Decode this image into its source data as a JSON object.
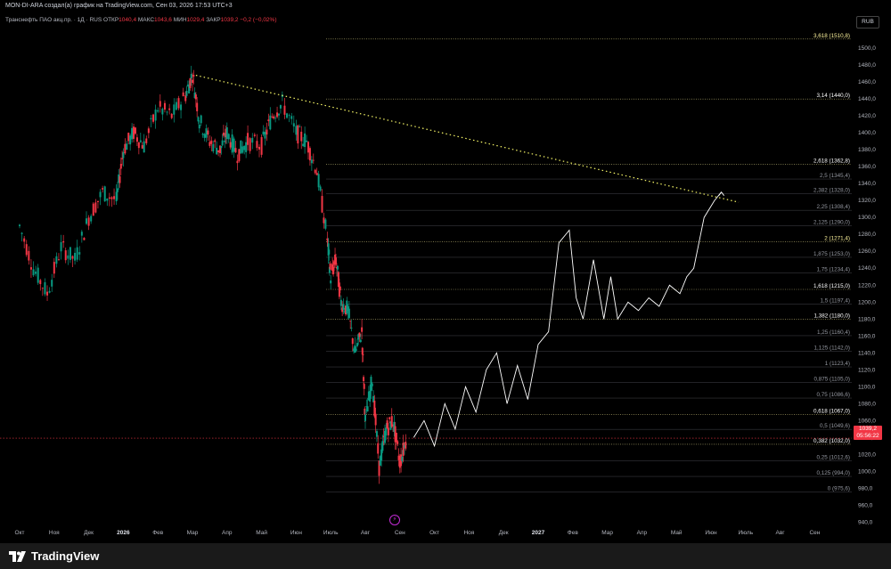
{
  "header": {
    "title": "MON-DI-ARA создал(а) график на TradingView.com, Сен 03, 2026 17:53 UTC+3",
    "symbol": "Транснефть ПАО акц.пр. · 1Д · RUS",
    "ohlc": [
      {
        "k": "ОТКР",
        "v": "1040,4"
      },
      {
        "k": "МАКС",
        "v": "1043,6"
      },
      {
        "k": "МИН",
        "v": "1029,4"
      },
      {
        "k": "ЗАКР",
        "v": "1039,2 −0,2 (−0,02%)"
      }
    ]
  },
  "currency": "RUB",
  "last_price": {
    "value": "1039,2",
    "countdown": "05:56:22",
    "color": "#f23645"
  },
  "footer": {
    "brand": "TradingView"
  },
  "colors": {
    "up": "#089981",
    "down": "#f23645",
    "fib": "#787b86",
    "fib_key": "#fff59d",
    "trend": "#f5f567",
    "projection": "#ffffff"
  },
  "chart_data": {
    "type": "line",
    "x_ticks": [
      "Окт",
      "Ноя",
      "Дек",
      "2026",
      "Фев",
      "Мар",
      "Апр",
      "Май",
      "Июн",
      "Июль",
      "Авг",
      "Сен",
      "Окт",
      "Ноя",
      "Дек",
      "2027",
      "Фев",
      "Мар",
      "Апр",
      "Май",
      "Июн",
      "Июль",
      "Авг",
      "Сен"
    ],
    "y_ticks": [
      "1500,0",
      "1480,0",
      "1460,0",
      "1440,0",
      "1420,0",
      "1400,0",
      "1380,0",
      "1360,0",
      "1340,0",
      "1320,0",
      "1300,0",
      "1280,0",
      "1260,0",
      "1240,0",
      "1220,0",
      "1200,0",
      "1180,0",
      "1160,0",
      "1140,0",
      "1120,0",
      "1100,0",
      "1080,0",
      "1060,0",
      "1040,0",
      "1020,0",
      "1000,0",
      "980,0",
      "960,0",
      "940,0"
    ],
    "ylim": [
      932,
      1510
    ],
    "fib_levels": [
      {
        "label": "3,618 (1510,8)",
        "value": 1510.8,
        "key": true
      },
      {
        "label": "3,14 (1440,0)",
        "value": 1440.0,
        "key": true
      },
      {
        "label": "2,618 (1362,8)",
        "value": 1362.8,
        "key": true
      },
      {
        "label": "2,5 (1345,4)",
        "value": 1345.4,
        "key": false
      },
      {
        "label": "2,382 (1328,0)",
        "value": 1328.0,
        "key": false
      },
      {
        "label": "2,25 (1308,4)",
        "value": 1308.4,
        "key": false
      },
      {
        "label": "2,125 (1290,0)",
        "value": 1290.0,
        "key": false
      },
      {
        "label": "2 (1271,4)",
        "value": 1271.4,
        "key": true
      },
      {
        "label": "1,875 (1253,0)",
        "value": 1253.0,
        "key": false
      },
      {
        "label": "1,75 (1234,4)",
        "value": 1234.4,
        "key": false
      },
      {
        "label": "1,618 (1215,0)",
        "value": 1215.0,
        "key": true
      },
      {
        "label": "1,5 (1197,4)",
        "value": 1197.4,
        "key": false
      },
      {
        "label": "1,382 (1180,0)",
        "value": 1180.0,
        "key": true
      },
      {
        "label": "1,25 (1160,4)",
        "value": 1160.4,
        "key": false
      },
      {
        "label": "1,125 (1142,0)",
        "value": 1142.0,
        "key": false
      },
      {
        "label": "1 (1123,4)",
        "value": 1123.4,
        "key": false
      },
      {
        "label": "0,875 (1105,0)",
        "value": 1105.0,
        "key": false
      },
      {
        "label": "0,75 (1086,6)",
        "value": 1086.6,
        "key": false
      },
      {
        "label": "0,618 (1067,0)",
        "value": 1067.0,
        "key": true
      },
      {
        "label": "0,5 (1049,6)",
        "value": 1049.6,
        "key": false
      },
      {
        "label": "0,382 (1032,0)",
        "value": 1032.0,
        "key": true
      },
      {
        "label": "0,25 (1012,6)",
        "value": 1012.6,
        "key": false
      },
      {
        "label": "0,125 (994,0)",
        "value": 994.0,
        "key": false
      },
      {
        "label": "0 (975,6)",
        "value": 975.6,
        "key": false
      }
    ],
    "price_history": {
      "x": [
        0,
        0.4,
        0.8,
        1.2,
        1.6,
        2,
        2.4,
        2.8,
        3.0,
        3.3,
        3.6,
        4.0,
        4.4,
        4.8,
        5.0,
        5.2,
        5.5,
        5.8,
        6.0,
        6.3,
        6.6,
        7.0,
        7.3,
        7.6,
        8.0,
        8.3,
        8.6,
        8.9,
        9.0,
        9.15,
        9.3,
        9.5,
        9.7,
        9.9,
        10.0,
        10.2,
        10.4,
        10.6,
        10.8,
        11.0,
        11.2
      ],
      "y": [
        1290,
        1240,
        1210,
        1265,
        1250,
        1300,
        1330,
        1320,
        1380,
        1400,
        1385,
        1430,
        1420,
        1445,
        1470,
        1415,
        1390,
        1380,
        1400,
        1375,
        1390,
        1385,
        1420,
        1435,
        1400,
        1390,
        1355,
        1275,
        1230,
        1250,
        1200,
        1190,
        1140,
        1165,
        1060,
        1110,
        1005,
        1050,
        1060,
        1010,
        1040
      ]
    },
    "projection": {
      "x": [
        11.4,
        11.7,
        12.0,
        12.3,
        12.6,
        12.9,
        13.2,
        13.5,
        13.8,
        14.1,
        14.4,
        14.7,
        15.0,
        15.3,
        15.6,
        15.9,
        16.1,
        16.3,
        16.6,
        16.9,
        17.1,
        17.3,
        17.6,
        17.9,
        18.2,
        18.5,
        18.8,
        19.1,
        19.3,
        19.5,
        19.8,
        20.1,
        20.3
      ],
      "y": [
        1040,
        1060,
        1030,
        1080,
        1050,
        1100,
        1070,
        1120,
        1140,
        1080,
        1125,
        1085,
        1150,
        1165,
        1270,
        1285,
        1205,
        1180,
        1250,
        1180,
        1230,
        1180,
        1200,
        1190,
        1205,
        1195,
        1220,
        1210,
        1230,
        1240,
        1300,
        1320,
        1330
      ]
    },
    "trendline": {
      "x": [
        5.1,
        20.8
      ],
      "y": [
        1468,
        1318
      ]
    },
    "xlabel": "",
    "ylabel": ""
  }
}
